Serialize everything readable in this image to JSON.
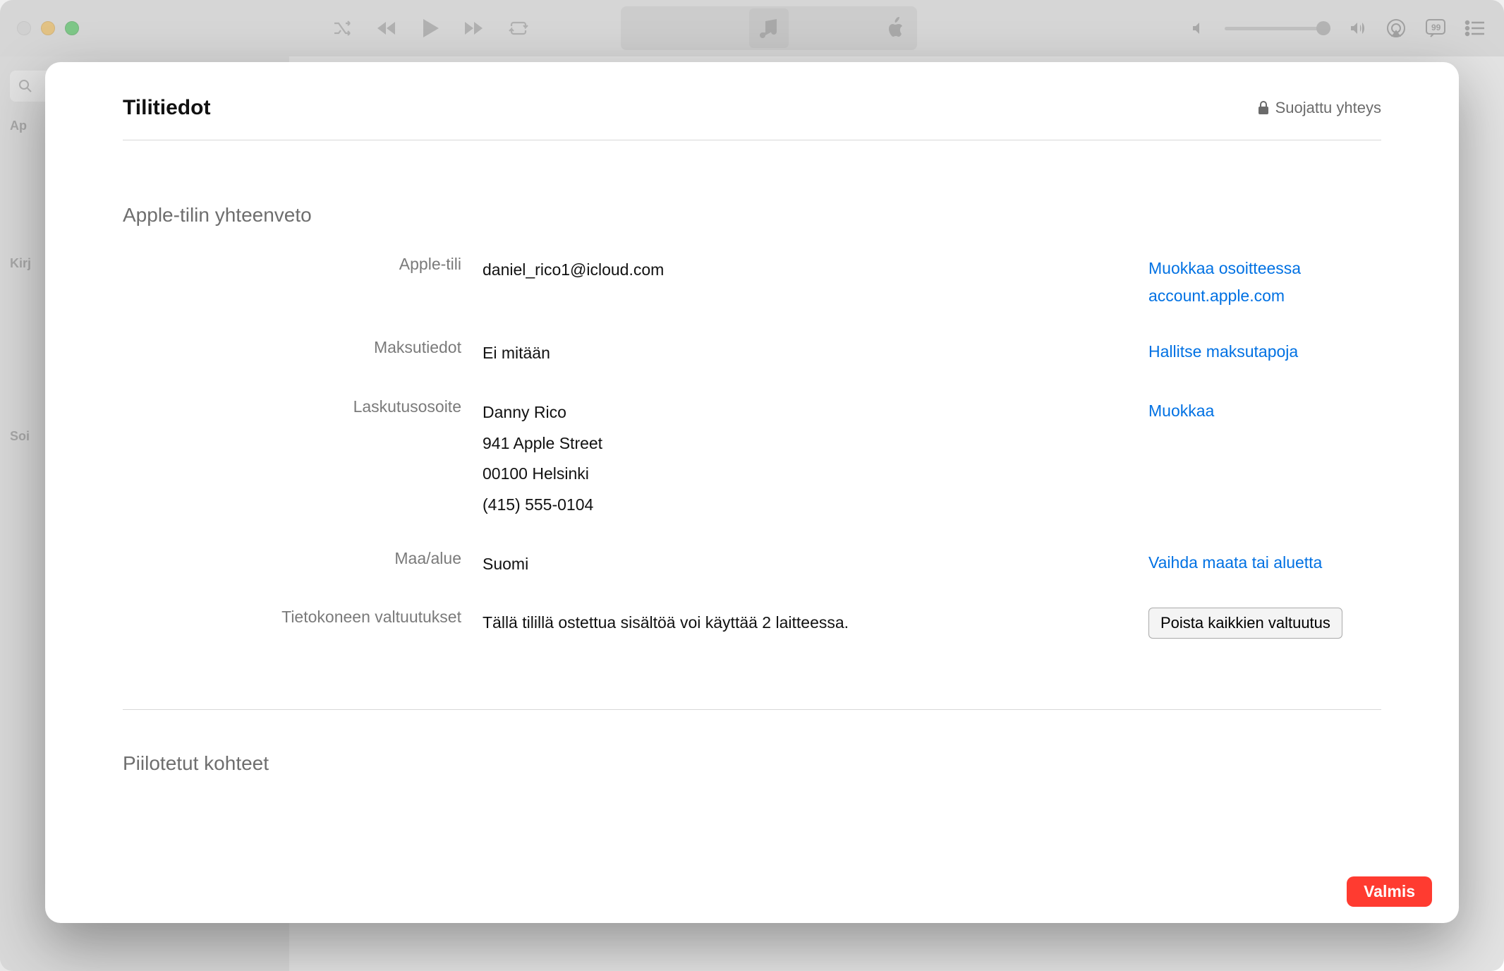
{
  "sidebar": {
    "section1_label": "Ap",
    "section2_label": "Kirj",
    "section3_label": "Soi"
  },
  "modal": {
    "title": "Tilitiedot",
    "secure_label": "Suojattu yhteys",
    "section1_heading": "Apple-tilin yhteenveto",
    "section2_heading": "Piilotetut kohteet",
    "rows": {
      "apple_id": {
        "label": "Apple-tili",
        "value": "daniel_rico1@icloud.com",
        "action_line1": "Muokkaa osoitteessa",
        "action_line2": "account.apple.com"
      },
      "payment": {
        "label": "Maksutiedot",
        "value": "Ei mitään",
        "action": "Hallitse maksutapoja"
      },
      "billing": {
        "label": "Laskutusosoite",
        "line1": "Danny Rico",
        "line2": "941 Apple Street",
        "line3": "00100 Helsinki",
        "line4": "(415) 555-0104",
        "action": "Muokkaa"
      },
      "country": {
        "label": "Maa/alue",
        "value": "Suomi",
        "action": "Vaihda maata tai aluetta"
      },
      "auth": {
        "label": "Tietokoneen valtuutukset",
        "value": "Tällä tilillä ostettua sisältöä voi käyttää 2 laitteessa.",
        "action": "Poista kaikkien valtuutus"
      }
    },
    "done_button": "Valmis"
  }
}
